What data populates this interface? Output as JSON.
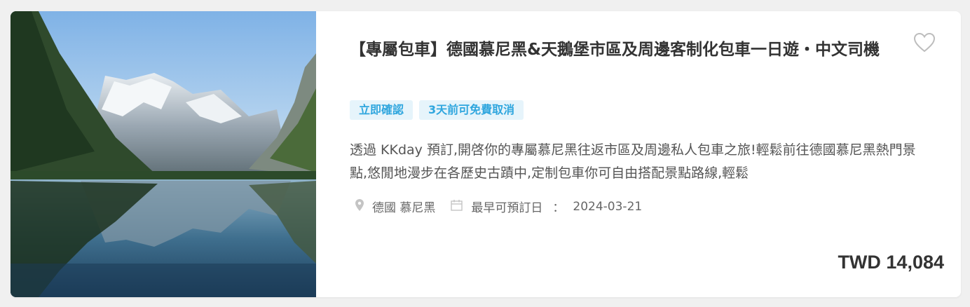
{
  "product": {
    "title": "【專屬包車】德國慕尼黑&天鵝堡市區及周邊客制化包車一日遊・中文司機",
    "tags": [
      "立即確認",
      "3天前可免費取消"
    ],
    "description": "透過 KKday 預訂,開啓你的專屬慕尼黑往返市區及周邊私人包車之旅!輕鬆前往德國慕尼黑熱門景點,悠閒地漫步在各歷史古蹟中,定制包車你可自由搭配景點路線,輕鬆",
    "location": "德國 慕尼黑",
    "earliest_label": "最早可預訂日",
    "earliest_separator": "：",
    "earliest_date": "2024-03-21",
    "price": "TWD 14,084"
  },
  "icons": {
    "favorite": "heart-outline-icon",
    "location": "map-pin-icon",
    "date": "calendar-icon"
  },
  "colors": {
    "tag_bg": "#e6f4fb",
    "tag_text": "#2fa6de",
    "title": "#333333",
    "text": "#555555",
    "meta_icon": "#bbbbbb"
  }
}
